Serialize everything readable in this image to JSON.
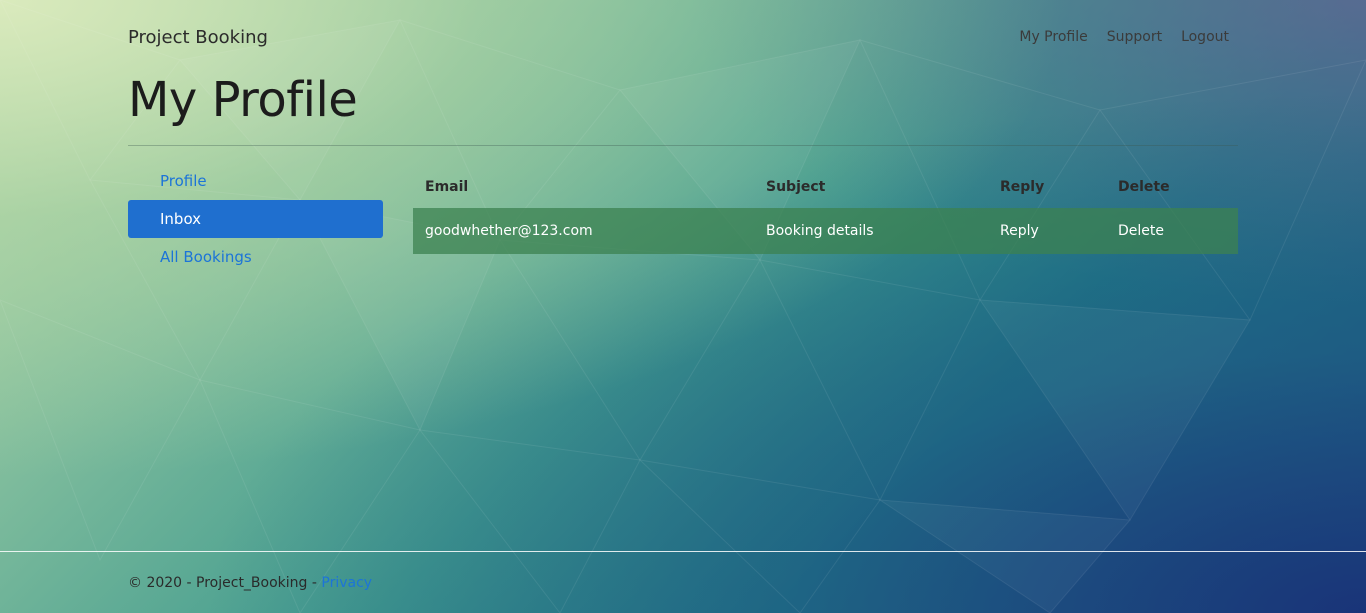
{
  "navbar": {
    "brand": "Project Booking",
    "links": [
      "My Profile",
      "Support",
      "Logout"
    ]
  },
  "page": {
    "title": "My Profile"
  },
  "sidebar": {
    "items": [
      {
        "label": "Profile",
        "active": false
      },
      {
        "label": "Inbox",
        "active": true
      },
      {
        "label": "All Bookings",
        "active": false
      }
    ]
  },
  "inbox": {
    "columns": [
      "Email",
      "Subject",
      "Reply",
      "Delete"
    ],
    "rows": [
      {
        "email": "goodwhether@123.com",
        "subject": "Booking details",
        "reply": "Reply",
        "delete": "Delete"
      }
    ]
  },
  "footer": {
    "copyright": "© 2020 - Project_Booking - ",
    "privacy": "Privacy"
  },
  "colors": {
    "accent": "#1f6fcf",
    "link": "#1c74d8",
    "row_bg": "#3c8250"
  }
}
